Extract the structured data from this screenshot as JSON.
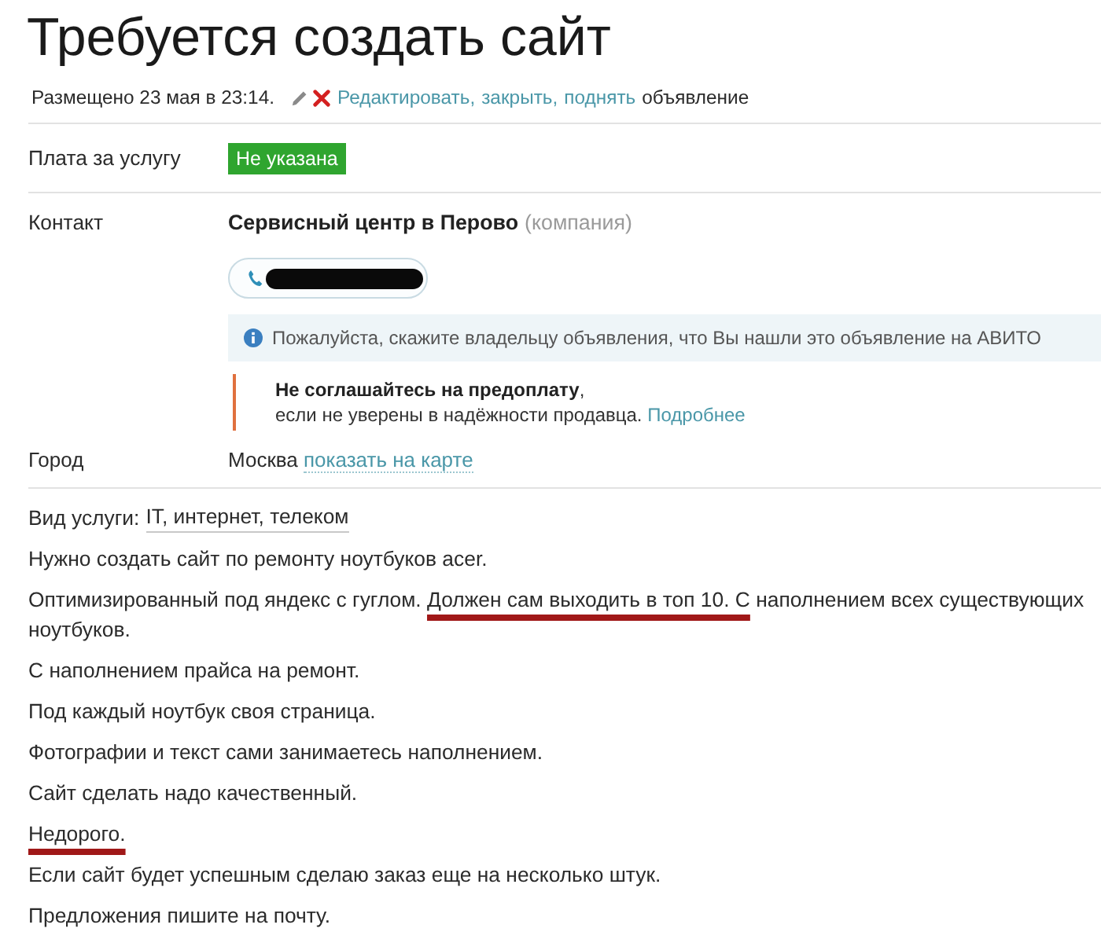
{
  "title": "Требуется создать сайт",
  "meta": {
    "posted": "Размещено 23 мая в 23:14.",
    "actions": [
      "Редактировать,",
      "закрыть,",
      "поднять"
    ],
    "suffix": "объявление"
  },
  "price": {
    "label": "Плата за услугу",
    "value": "Не указана"
  },
  "contact": {
    "label": "Контакт",
    "name": "Сервисный центр в Перово",
    "type": "(компания)",
    "phone": {
      "redacted": true
    },
    "notice": "Пожалуйста, скажите владельцу объявления, что Вы нашли это объявление на АВИТО",
    "warning": {
      "lines": [
        "**Не соглашайтесь на предоплату**,",
        "если не уверены в надёжности продавца."
      ],
      "link": "Подробнее"
    }
  },
  "city": {
    "label": "Город",
    "value": "Москва",
    "link": "показать на карте"
  },
  "service_type": {
    "label": "Вид услуги:",
    "value": "IT, интернет, телеком"
  },
  "description": [
    {
      "parts": [
        {
          "text": "Нужно создать сайт по ремонту ноутбуков acer.",
          "marked": false
        }
      ]
    },
    {
      "parts": [
        {
          "text": "Оптимизированный под яндекс с гуглом. ",
          "marked": false
        },
        {
          "text": "Должен сам выходить в топ 10. С",
          "marked": true
        },
        {
          "text": " наполнением всех существующих ноутбуков.",
          "marked": false
        }
      ]
    },
    {
      "parts": [
        {
          "text": "С наполнением прайса на ремонт.",
          "marked": false
        }
      ]
    },
    {
      "parts": [
        {
          "text": "Под каждый ноутбук своя страница.",
          "marked": false
        }
      ]
    },
    {
      "parts": [
        {
          "text": "Фотографии и текст сами занимаетесь наполнением.",
          "marked": false
        }
      ]
    },
    {
      "parts": [
        {
          "text": "Сайт сделать надо качественный.",
          "marked": false
        }
      ]
    },
    {
      "parts": [
        {
          "text": "Недорого.",
          "marked": true
        }
      ]
    },
    {
      "parts": [
        {
          "text": "Если сайт будет успешным сделаю заказ еще на несколько штук.",
          "marked": false
        }
      ]
    },
    {
      "parts": [
        {
          "text": "Предложения пишите на почту.",
          "marked": false
        }
      ]
    }
  ]
}
